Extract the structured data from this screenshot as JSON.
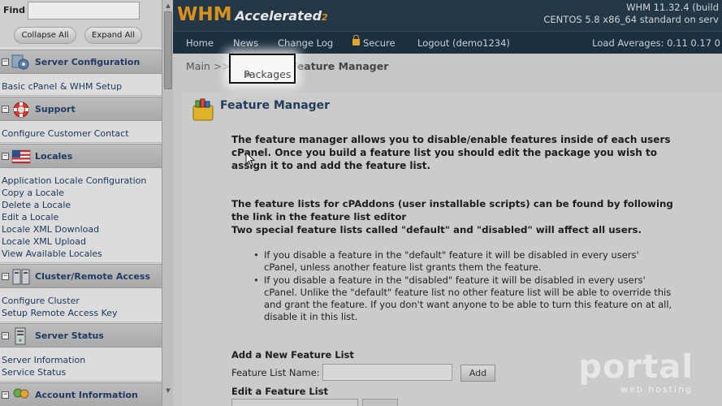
{
  "sidebar": {
    "find_label": "Find",
    "find_value": "",
    "collapse_all": "Collapse All",
    "expand_all": "Expand All",
    "categories": [
      {
        "label": "Server Configuration",
        "icon": "gear-icon",
        "links": [
          "Basic cPanel & WHM Setup"
        ]
      },
      {
        "label": "Support",
        "icon": "lifebuoy-icon",
        "links": [
          "Configure Customer Contact"
        ]
      },
      {
        "label": "Locales",
        "icon": "flag-icon",
        "links": [
          "Application Locale Configuration",
          "Copy a Locale",
          "Delete a Locale",
          "Edit a Locale",
          "Locale XML Download",
          "Locale XML Upload",
          "View Available Locales"
        ]
      },
      {
        "label": "Cluster/Remote Access",
        "icon": "servers-icon",
        "links": [
          "Configure Cluster",
          "Setup Remote Access Key"
        ]
      },
      {
        "label": "Server Status",
        "icon": "server-icon",
        "links": [
          "Server Information",
          "Service Status"
        ]
      },
      {
        "label": "Account Information",
        "icon": "users-icon",
        "links": []
      }
    ],
    "toggle_symbol": "−"
  },
  "header": {
    "logo_main": "WHM",
    "logo_accelerated": "Accelerated",
    "logo_2": "2",
    "build_line1": "WHM 11.32.4 (build",
    "build_line2": "CENTOS 5.8 x86_64 standard on serv"
  },
  "nav": {
    "home": "Home",
    "news": "News",
    "changelog": "Change Log",
    "secure": "Secure",
    "logout": "Logout (demo1234)",
    "load": "Load Averages: 0.11 0.17 0"
  },
  "breadcrumb": {
    "main": "Main",
    "sep": ">>",
    "packages": "Packages",
    "sep2": ">",
    "current": "Feature Manager"
  },
  "page": {
    "title": "Feature Manager",
    "intro": [
      "The feature manager allows you to disable/enable features inside of each users",
      "cPanel. Once you build a feature list you should edit the package you wish to",
      "assign it to and add the feature list."
    ],
    "addons": [
      "The feature lists for cPAddons (user installable scripts) can be found by following",
      "the link in the feature list editor",
      "Two special feature lists called \"default\" and \"disabled\" will affect all users."
    ],
    "bullet1": [
      "If you disable a feature in the \"default\" feature it will be disabled in every users'",
      "cPanel, unless another feature list grants them the feature."
    ],
    "bullet2": [
      "If you disable a feature in the \"disabled\" feature it will be disabled in every users'",
      "cPanel. Unlike the \"default\" feature list no other feature list will be able to override this",
      "and grant the feature. If you don't want anyone to be able to turn this feature on at all,",
      "disable it in this list."
    ],
    "add_heading": "Add a New Feature List",
    "name_label": "Feature List Name:",
    "name_value": "",
    "add_button": "Add",
    "edit_heading": "Edit a Feature List"
  },
  "watermark": {
    "brand": "portal",
    "sub": "web hosting"
  }
}
